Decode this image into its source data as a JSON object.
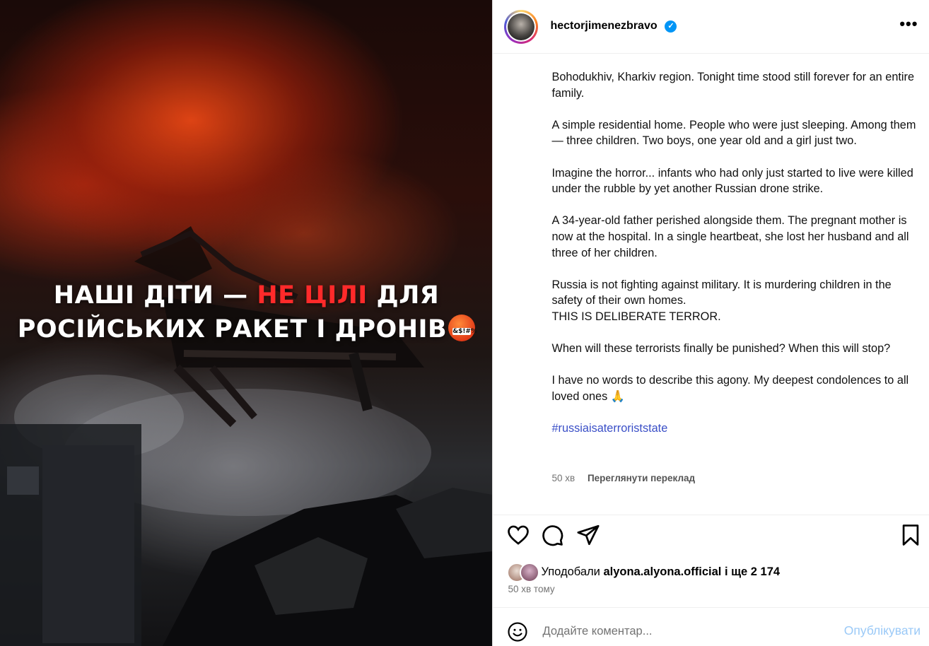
{
  "media": {
    "headline_line1_white": "НАШІ ДІТИ —",
    "headline_line1_red": "НЕ ЦІЛІ",
    "headline_line1_end": "ДЛЯ",
    "headline_line2": "РОСІЙСЬКИХ РАКЕТ І ДРОНІВ",
    "emoji_symbols": "&$!#%",
    "emoji_icon": "angry-face-icon",
    "accent_red": "#ff2a2a"
  },
  "post_header": {
    "username": "hectorjimenezbravo",
    "verified_icon": "verified-badge-icon",
    "more_label": "•••"
  },
  "caption": {
    "paragraphs": [
      "Bohodukhiv, Kharkiv region. Tonight time stood still forever for an entire family.",
      "A simple residential home. People who were just sleeping. Among them — three children. Two boys, one year old and a girl just two.",
      "Imagine the horror... infants who had only just started to live were killed under the rubble by yet another Russian drone strike.",
      "A 34-year-old father perished alongside them. The pregnant mother is now at the hospital. In a single heartbeat, she lost her husband and all three of her children.",
      "Russia is not fighting against military. It is murdering children in the safety of their own homes.",
      "THIS IS DELIBERATE TERROR.",
      "When will these terrorists finally be punished? When this will stop?",
      "I have no words to describe this agony. My deepest condolences to all loved ones"
    ],
    "praying_emoji": "🙏",
    "hashtag": "#russiaisaterroriststate",
    "age": "50 хв",
    "translate_label": "Переглянути переклад"
  },
  "likes": {
    "prefix": "Уподобали",
    "user": "alyona.alyona.official",
    "and_more": "і ще 2 174"
  },
  "time_ago": "50 хв тому",
  "comment": {
    "placeholder": "Додайте коментар...",
    "publish_label": "Опублікувати"
  }
}
